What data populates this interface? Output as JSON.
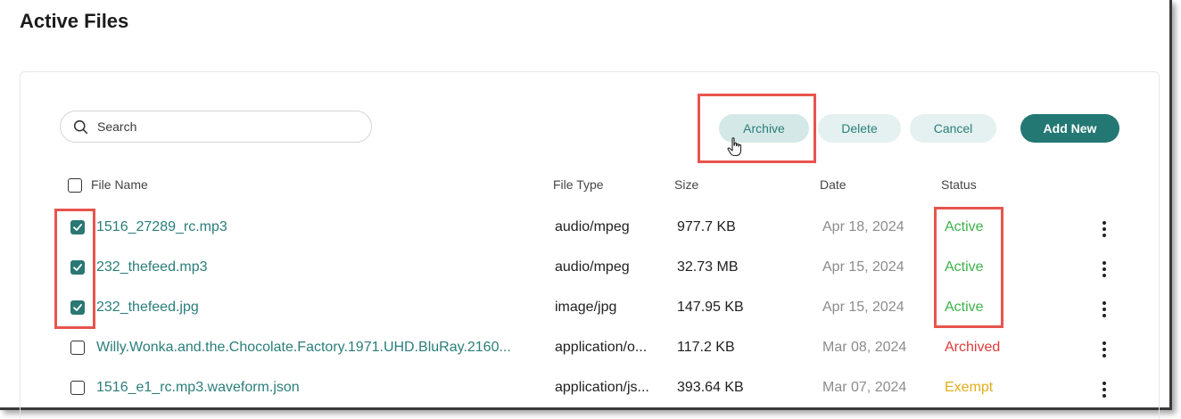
{
  "page": {
    "title": "Active Files"
  },
  "search": {
    "placeholder": "Search"
  },
  "toolbar": {
    "archive_label": "Archive",
    "delete_label": "Delete",
    "cancel_label": "Cancel",
    "add_new_label": "Add New"
  },
  "table": {
    "headers": {
      "name": "File Name",
      "type": "File Type",
      "size": "Size",
      "date": "Date",
      "status": "Status"
    },
    "rows": [
      {
        "checked": true,
        "name": "1516_27289_rc.mp3",
        "type": "audio/mpeg",
        "size": "977.7 KB",
        "date": "Apr 18, 2024",
        "status": "Active"
      },
      {
        "checked": true,
        "name": "232_thefeed.mp3",
        "type": "audio/mpeg",
        "size": "32.73 MB",
        "date": "Apr 15, 2024",
        "status": "Active"
      },
      {
        "checked": true,
        "name": "232_thefeed.jpg",
        "type": "image/jpg",
        "size": "147.95 KB",
        "date": "Apr 15, 2024",
        "status": "Active"
      },
      {
        "checked": false,
        "name": "Willy.Wonka.and.the.Chocolate.Factory.1971.UHD.BluRay.2160...",
        "type": "application/o...",
        "size": "117.2 KB",
        "date": "Mar 08, 2024",
        "status": "Archived"
      },
      {
        "checked": false,
        "name": "1516_e1_rc.mp3.waveform.json",
        "type": "application/js...",
        "size": "393.64 KB",
        "date": "Mar 07, 2024",
        "status": "Exempt"
      }
    ]
  },
  "colors": {
    "accent": "#237874",
    "link": "#2a7e7a",
    "active": "#3cb34a",
    "archived": "#dc3b3b",
    "exempt": "#e4ad1c",
    "highlight": "#e8544e"
  }
}
